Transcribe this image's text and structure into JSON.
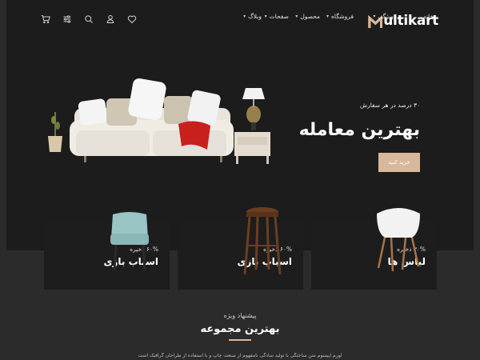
{
  "brand": {
    "logo_text": "ultikart",
    "accent_color": "#d9b79a"
  },
  "nav": {
    "home": "خانه",
    "items": [
      {
        "label": "ویژگی"
      },
      {
        "label": "فروشگاه"
      },
      {
        "label": "محصول"
      },
      {
        "label": "صفحات"
      },
      {
        "label": "وبلاگ"
      }
    ]
  },
  "header_icons": [
    "cart-icon",
    "settings-icon",
    "search-icon",
    "user-icon",
    "heart-icon"
  ],
  "hero": {
    "subtitle": "۳۰ درصد در هر سفارش",
    "title": "بهترین معامله",
    "button": "خرید کنید"
  },
  "cards": [
    {
      "discount": "۳۰% ذخیره",
      "title": "لباس ها"
    },
    {
      "discount": "۶۰% ذخیره",
      "title": "اسباب بازی"
    },
    {
      "discount": "۶۰% ذخیره",
      "title": "اسباب بازی"
    }
  ],
  "special": {
    "subtitle": "پیشنهاد ویژه",
    "title": "بهترین مجموعه",
    "body": "لورم ایپسوم متن ساختگی با تولید سادگی نامفهوم از صنعت چاپ و با استفاده از طراحان گرافیک است"
  }
}
